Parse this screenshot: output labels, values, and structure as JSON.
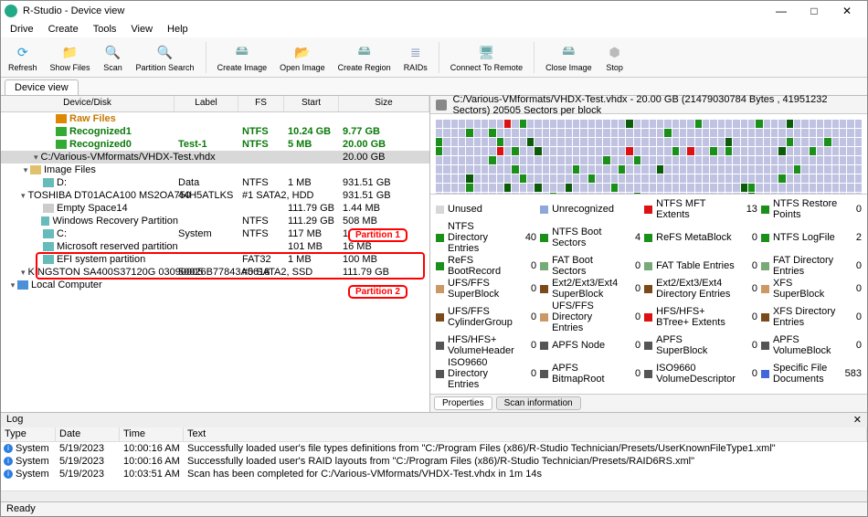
{
  "window": {
    "title": "R-Studio - Device view"
  },
  "winbtns": {
    "min": "—",
    "max": "□",
    "close": "✕"
  },
  "menu": [
    "Drive",
    "Create",
    "Tools",
    "View",
    "Help"
  ],
  "toolbar": [
    {
      "id": "refresh",
      "label": "Refresh",
      "color": "#2a9fd6",
      "glyph": "⟳"
    },
    {
      "id": "show-files",
      "label": "Show Files",
      "color": "#e0c06a",
      "glyph": "📁"
    },
    {
      "id": "scan",
      "label": "Scan",
      "color": "#5bb",
      "glyph": "🔍"
    },
    {
      "id": "partition-search",
      "label": "Partition Search",
      "color": "#5bb",
      "glyph": "🔍"
    },
    {
      "sep": true
    },
    {
      "id": "create-image",
      "label": "Create Image",
      "color": "#7aa",
      "glyph": "🖴"
    },
    {
      "id": "open-image",
      "label": "Open Image",
      "color": "#7aa",
      "glyph": "📂"
    },
    {
      "id": "create-region",
      "label": "Create Region",
      "color": "#7aa",
      "glyph": "🖴"
    },
    {
      "id": "raids",
      "label": "RAIDs",
      "color": "#89b",
      "glyph": "≣"
    },
    {
      "sep": true
    },
    {
      "id": "connect-remote",
      "label": "Connect To Remote",
      "color": "#6aa",
      "glyph": "🖥"
    },
    {
      "sep": true
    },
    {
      "id": "close-image",
      "label": "Close Image",
      "color": "#7aa",
      "glyph": "🖴"
    },
    {
      "id": "stop",
      "label": "Stop",
      "color": "#bbb",
      "glyph": "⬢"
    }
  ],
  "tab": {
    "label": "Device view"
  },
  "tree": {
    "headers": {
      "dev": "Device/Disk",
      "lbl": "Label",
      "fs": "FS",
      "start": "Start",
      "size": "Size"
    },
    "rows": [
      {
        "d": 0,
        "exp": "▾",
        "icon": "pc",
        "name": "Local Computer"
      },
      {
        "d": 1,
        "exp": "▾",
        "icon": "hdd",
        "name": "KINGSTON SA400S37120G 03090005",
        "lbl": "50026B77843A5618",
        "fs": "#0 SATA2, SSD",
        "size": "111.79 GB"
      },
      {
        "d": 2,
        "icon": "vol",
        "name": "EFI system partition",
        "fs": "FAT32",
        "start": "1 MB",
        "size": "100 MB"
      },
      {
        "d": 2,
        "icon": "vol",
        "name": "Microsoft reserved partition",
        "start": "101 MB",
        "size": "16 MB"
      },
      {
        "d": 2,
        "icon": "vol",
        "name": "C:",
        "lbl": "System",
        "fs": "NTFS",
        "start": "117 MB",
        "size": "111.18 GB"
      },
      {
        "d": 2,
        "icon": "vol",
        "name": "Windows Recovery Partition",
        "fs": "NTFS",
        "start": "111.29 GB",
        "size": "508 MB"
      },
      {
        "d": 2,
        "icon": "empty",
        "name": "Empty Space14",
        "start": "111.79 GB",
        "size": "1.44 MB"
      },
      {
        "d": 1,
        "exp": "▾",
        "icon": "hdd",
        "name": "TOSHIBA DT01ACA100 MS2OA750",
        "lbl": "44H5ATLKS",
        "fs": "#1 SATA2, HDD",
        "size": "931.51 GB"
      },
      {
        "d": 2,
        "icon": "vol",
        "name": "D:",
        "lbl": "Data",
        "fs": "NTFS",
        "start": "1 MB",
        "size": "931.51 GB"
      },
      {
        "d": 1,
        "exp": "▾",
        "icon": "folder",
        "name": "Image Files"
      },
      {
        "d": 2,
        "exp": "▾",
        "icon": "img",
        "name": "C:/Various-VMformats/VHDX-Test.vhdx",
        "size": "20.00 GB",
        "sel": true
      },
      {
        "d": 3,
        "icon": "rec",
        "name": "Recognized0",
        "lbl": "Test-1",
        "fs": "NTFS",
        "start": "5 MB",
        "size": "20.00 GB",
        "green": true
      },
      {
        "d": 3,
        "icon": "rec",
        "name": "Recognized1",
        "fs": "NTFS",
        "start": "10.24 GB",
        "size": "9.77 GB",
        "green": true
      },
      {
        "d": 3,
        "icon": "raw",
        "name": "Raw Files",
        "orange": true
      }
    ]
  },
  "annotations": {
    "p1": "Partition 1",
    "p2": "Partition 2"
  },
  "right": {
    "header": "C:/Various-VMformats/VHDX-Test.vhdx - 20.00 GB (21479030784 Bytes , 41951232 Sectors) 20505 Sectors per block"
  },
  "legend": [
    {
      "c": "#d7d7d7",
      "t": "Unused",
      "n": ""
    },
    {
      "c": "#8fa8d8",
      "t": "Unrecognized",
      "n": ""
    },
    {
      "c": "#d11",
      "t": "NTFS MFT Extents",
      "n": "13"
    },
    {
      "c": "#1a8f1a",
      "t": "NTFS Restore Points",
      "n": "0"
    },
    {
      "c": "#1a8f1a",
      "t": "NTFS Directory Entries",
      "n": "40"
    },
    {
      "c": "#1a8f1a",
      "t": "NTFS Boot Sectors",
      "n": "4"
    },
    {
      "c": "#1a8f1a",
      "t": "ReFS MetaBlock",
      "n": "0"
    },
    {
      "c": "#1a8f1a",
      "t": "NTFS LogFile",
      "n": "2"
    },
    {
      "c": "#1a8f1a",
      "t": "ReFS BootRecord",
      "n": "0"
    },
    {
      "c": "#7a7",
      "t": "FAT Boot Sectors",
      "n": "0"
    },
    {
      "c": "#7a7",
      "t": "FAT Table Entries",
      "n": "0"
    },
    {
      "c": "#7a7",
      "t": "FAT Directory Entries",
      "n": "0"
    },
    {
      "c": "#c96",
      "t": "UFS/FFS SuperBlock",
      "n": "0"
    },
    {
      "c": "#7a4a1a",
      "t": "Ext2/Ext3/Ext4 SuperBlock",
      "n": "0"
    },
    {
      "c": "#7a4a1a",
      "t": "Ext2/Ext3/Ext4 Directory Entries",
      "n": "0"
    },
    {
      "c": "#c96",
      "t": "XFS SuperBlock",
      "n": "0"
    },
    {
      "c": "#7a4a1a",
      "t": "UFS/FFS CylinderGroup",
      "n": "0"
    },
    {
      "c": "#c96",
      "t": "UFS/FFS Directory Entries",
      "n": "0"
    },
    {
      "c": "#d11",
      "t": "HFS/HFS+ BTree+ Extents",
      "n": "0"
    },
    {
      "c": "#7a4a1a",
      "t": "XFS Directory Entries",
      "n": "0"
    },
    {
      "c": "#555",
      "t": "HFS/HFS+ VolumeHeader",
      "n": "0"
    },
    {
      "c": "#555",
      "t": "APFS Node",
      "n": "0"
    },
    {
      "c": "#555",
      "t": "APFS SuperBlock",
      "n": "0"
    },
    {
      "c": "#555",
      "t": "APFS VolumeBlock",
      "n": "0"
    },
    {
      "c": "#555",
      "t": "ISO9660 Directory Entries",
      "n": "0"
    },
    {
      "c": "#555",
      "t": "APFS BitmapRoot",
      "n": "0"
    },
    {
      "c": "#555",
      "t": "ISO9660 VolumeDescriptor",
      "n": "0"
    },
    {
      "c": "#46d",
      "t": "Specific File Documents",
      "n": "583"
    }
  ],
  "rightTabs": {
    "props": "Properties",
    "scan": "Scan information"
  },
  "log": {
    "title": "Log",
    "headers": {
      "type": "Type",
      "date": "Date",
      "time": "Time",
      "text": "Text"
    },
    "rows": [
      {
        "type": "System",
        "date": "5/19/2023",
        "time": "10:00:16 AM",
        "text": "Successfully loaded user's file types definitions from \"C:/Program Files (x86)/R-Studio Technician/Presets/UserKnownFileType1.xml\""
      },
      {
        "type": "System",
        "date": "5/19/2023",
        "time": "10:00:16 AM",
        "text": "Successfully loaded user's RAID layouts from \"C:/Program Files (x86)/R-Studio Technician/Presets/RAID6RS.xml\""
      },
      {
        "type": "System",
        "date": "5/19/2023",
        "time": "10:03:51 AM",
        "text": "Scan has been completed for C:/Various-VMformats/VHDX-Test.vhdx in 1m 14s"
      }
    ]
  },
  "status": "Ready"
}
